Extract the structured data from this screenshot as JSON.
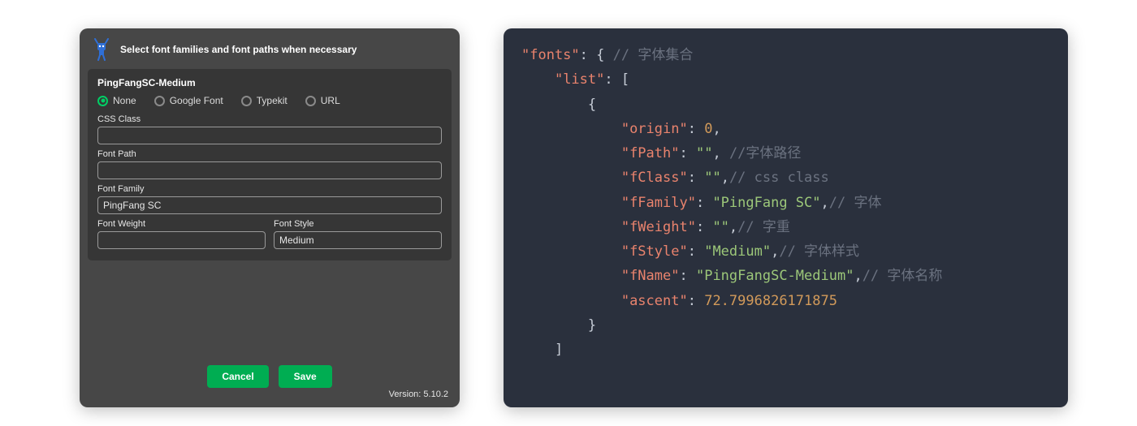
{
  "dialog": {
    "title": "Select font families and font paths when necessary",
    "font_name": "PingFangSC-Medium",
    "radios": {
      "none": "None",
      "google": "Google Font",
      "typekit": "Typekit",
      "url": "URL",
      "selected": "none"
    },
    "fields": {
      "css_class": {
        "label": "CSS Class",
        "value": ""
      },
      "font_path": {
        "label": "Font Path",
        "value": ""
      },
      "font_family": {
        "label": "Font Family",
        "value": "PingFang SC"
      },
      "font_weight": {
        "label": "Font Weight",
        "value": ""
      },
      "font_style": {
        "label": "Font Style",
        "value": "Medium"
      }
    },
    "buttons": {
      "cancel": "Cancel",
      "save": "Save"
    },
    "version_label": "Version: 5.10.2"
  },
  "code": {
    "root_key": "\"fonts\"",
    "root_comment": "// 字体集合",
    "list_key": "\"list\"",
    "entries": {
      "origin": {
        "key": "\"origin\"",
        "val": "0",
        "type": "num",
        "comment": ""
      },
      "fPath": {
        "key": "\"fPath\"",
        "val": "\"\"",
        "type": "str",
        "comment": "//字体路径"
      },
      "fClass": {
        "key": "\"fClass\"",
        "val": "\"\"",
        "type": "str",
        "comment": "// css class"
      },
      "fFamily": {
        "key": "\"fFamily\"",
        "val": "\"PingFang SC\"",
        "type": "str",
        "comment": "// 字体"
      },
      "fWeight": {
        "key": "\"fWeight\"",
        "val": "\"\"",
        "type": "str",
        "comment": "// 字重"
      },
      "fStyle": {
        "key": "\"fStyle\"",
        "val": "\"Medium\"",
        "type": "str",
        "comment": "// 字体样式"
      },
      "fName": {
        "key": "\"fName\"",
        "val": "\"PingFangSC-Medium\"",
        "type": "str",
        "comment": "// 字体名称"
      },
      "ascent": {
        "key": "\"ascent\"",
        "val": "72.7996826171875",
        "type": "num",
        "comment": ""
      }
    }
  }
}
